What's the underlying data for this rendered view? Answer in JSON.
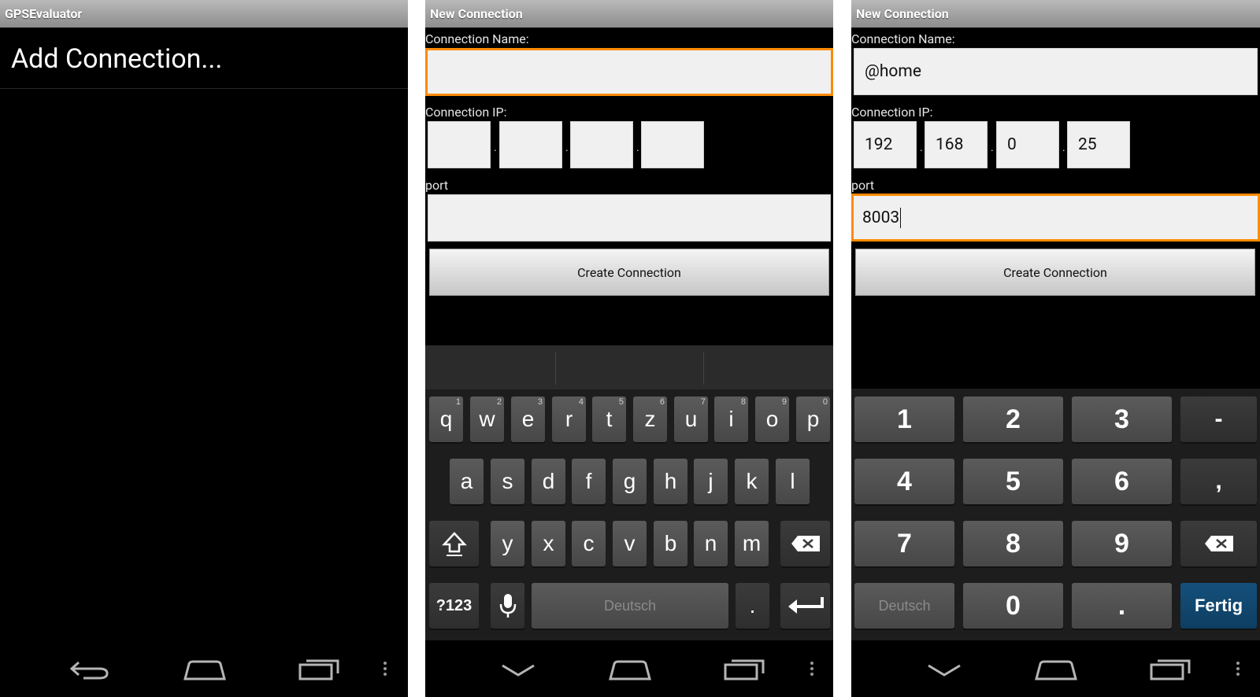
{
  "screen1": {
    "title": "GPSEvaluator",
    "menu_item": "Add Connection..."
  },
  "screen2": {
    "title": "New Connection",
    "name_label": "Connection Name:",
    "name_value": "",
    "ip_label": "Connection IP:",
    "ip_values": [
      "",
      "",
      "",
      ""
    ],
    "port_label": "port",
    "port_value": "",
    "create_button": "Create Connection",
    "keyboard": {
      "row1": [
        "q",
        "w",
        "e",
        "r",
        "t",
        "z",
        "u",
        "i",
        "o",
        "p"
      ],
      "row1_alt": [
        "1",
        "2",
        "3",
        "4",
        "5",
        "6",
        "7",
        "8",
        "9",
        "0"
      ],
      "row2": [
        "a",
        "s",
        "d",
        "f",
        "g",
        "h",
        "j",
        "k",
        "l"
      ],
      "row3": [
        "y",
        "x",
        "c",
        "v",
        "b",
        "n",
        "m"
      ],
      "symbols_key": "?123",
      "space_label": "Deutsch",
      "period_key": "."
    }
  },
  "screen3": {
    "title": "New Connection",
    "name_label": "Connection Name:",
    "name_value": "@home",
    "ip_label": "Connection IP:",
    "ip_values": [
      "192",
      "168",
      "0",
      "25"
    ],
    "port_label": "port",
    "port_value": "8003",
    "create_button": "Create Connection",
    "numpad": {
      "digits": [
        "1",
        "2",
        "3",
        "4",
        "5",
        "6",
        "7",
        "8",
        "9",
        "0"
      ],
      "minus": "-",
      "comma": ",",
      "period": ".",
      "space_label": "Deutsch",
      "done_label": "Fertig"
    }
  },
  "colors": {
    "focus": "#ff8a00",
    "done_key": "#0e3e62",
    "titlebar": "#a0a0a0"
  },
  "icons": [
    "back-icon",
    "home-icon",
    "recents-icon",
    "menu-icon",
    "shift-icon",
    "backspace-icon",
    "enter-icon",
    "microphone-icon",
    "hide-keyboard-icon"
  ]
}
